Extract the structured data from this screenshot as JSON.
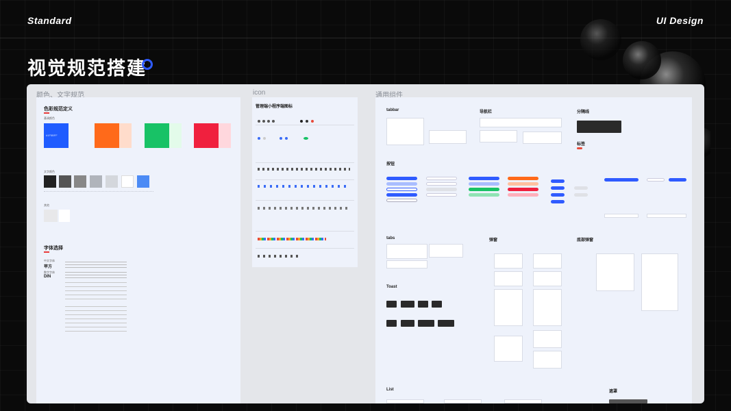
{
  "header": {
    "left_label": "Standard",
    "right_label": "UI Design",
    "title": "视觉规范搭建"
  },
  "sections": {
    "color_text": "颜色、文字规范",
    "icon": "icon",
    "components": "通用组件"
  },
  "color_panel": {
    "title": "色彩规范定义",
    "main_colors_label": "基调颜色",
    "primary_hex": "#1F5BFF",
    "swatches": [
      {
        "color": "#1f5cff",
        "light": "#eef2fb"
      },
      {
        "color": "#ff6a1a",
        "light": "#ffdccb"
      },
      {
        "color": "#18c266",
        "light": "#e3fbea"
      },
      {
        "color": "#f0203e",
        "light": "#ffd7dd"
      }
    ],
    "text_colors_label": "文字颜色",
    "grays": [
      "#222222",
      "#555555",
      "#888888",
      "#b0b4bb",
      "#d4d7dc",
      "#ffffff",
      "#4c8bf5"
    ],
    "other_label": "其他",
    "font_title": "字体选择",
    "cn_font_label": "中文字体",
    "cn_font": "苹方",
    "num_font_label": "数字字体",
    "num_font": "DIN"
  },
  "icon_panel": {
    "title": "管理端小程序端图标"
  },
  "components": {
    "tabbar": "tabbar",
    "navbar": "导航栏",
    "separator": "分隔线",
    "tag": "标签",
    "buttons": "按钮",
    "tabs": "tabs",
    "popup": "弹窗",
    "bottom_popup": "底部弹窗",
    "toast": "Toast",
    "list": "List",
    "mask": "遮罩"
  }
}
